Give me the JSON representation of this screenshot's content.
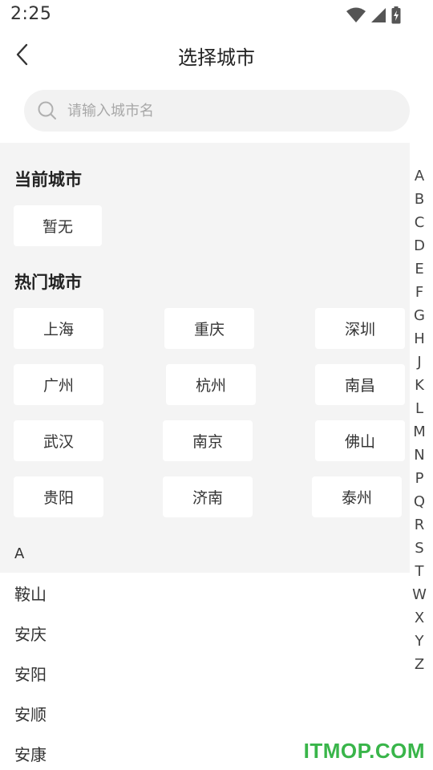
{
  "status_bar": {
    "time": "2:25"
  },
  "header": {
    "title": "选择城市"
  },
  "search": {
    "placeholder": "请输入城市名"
  },
  "current_city": {
    "title": "当前城市",
    "value": "暂无"
  },
  "hot_cities": {
    "title": "热门城市",
    "items": [
      "上海",
      "重庆",
      "深圳",
      "广州",
      "杭州",
      "南昌",
      "武汉",
      "南京",
      "佛山",
      "贵阳",
      "济南",
      "泰州"
    ]
  },
  "group": {
    "letter": "A"
  },
  "city_list": [
    "鞍山",
    "安庆",
    "安阳",
    "安顺",
    "安康"
  ],
  "alphabet": [
    "A",
    "B",
    "C",
    "D",
    "E",
    "F",
    "G",
    "H",
    "J",
    "K",
    "L",
    "M",
    "N",
    "P",
    "Q",
    "R",
    "S",
    "T",
    "W",
    "X",
    "Y",
    "Z"
  ],
  "watermark": "ITMOP.COM",
  "colors": {
    "watermark": "#39b54a",
    "section_bg": "#f4f4f4",
    "search_bg": "#f2f2f2"
  }
}
